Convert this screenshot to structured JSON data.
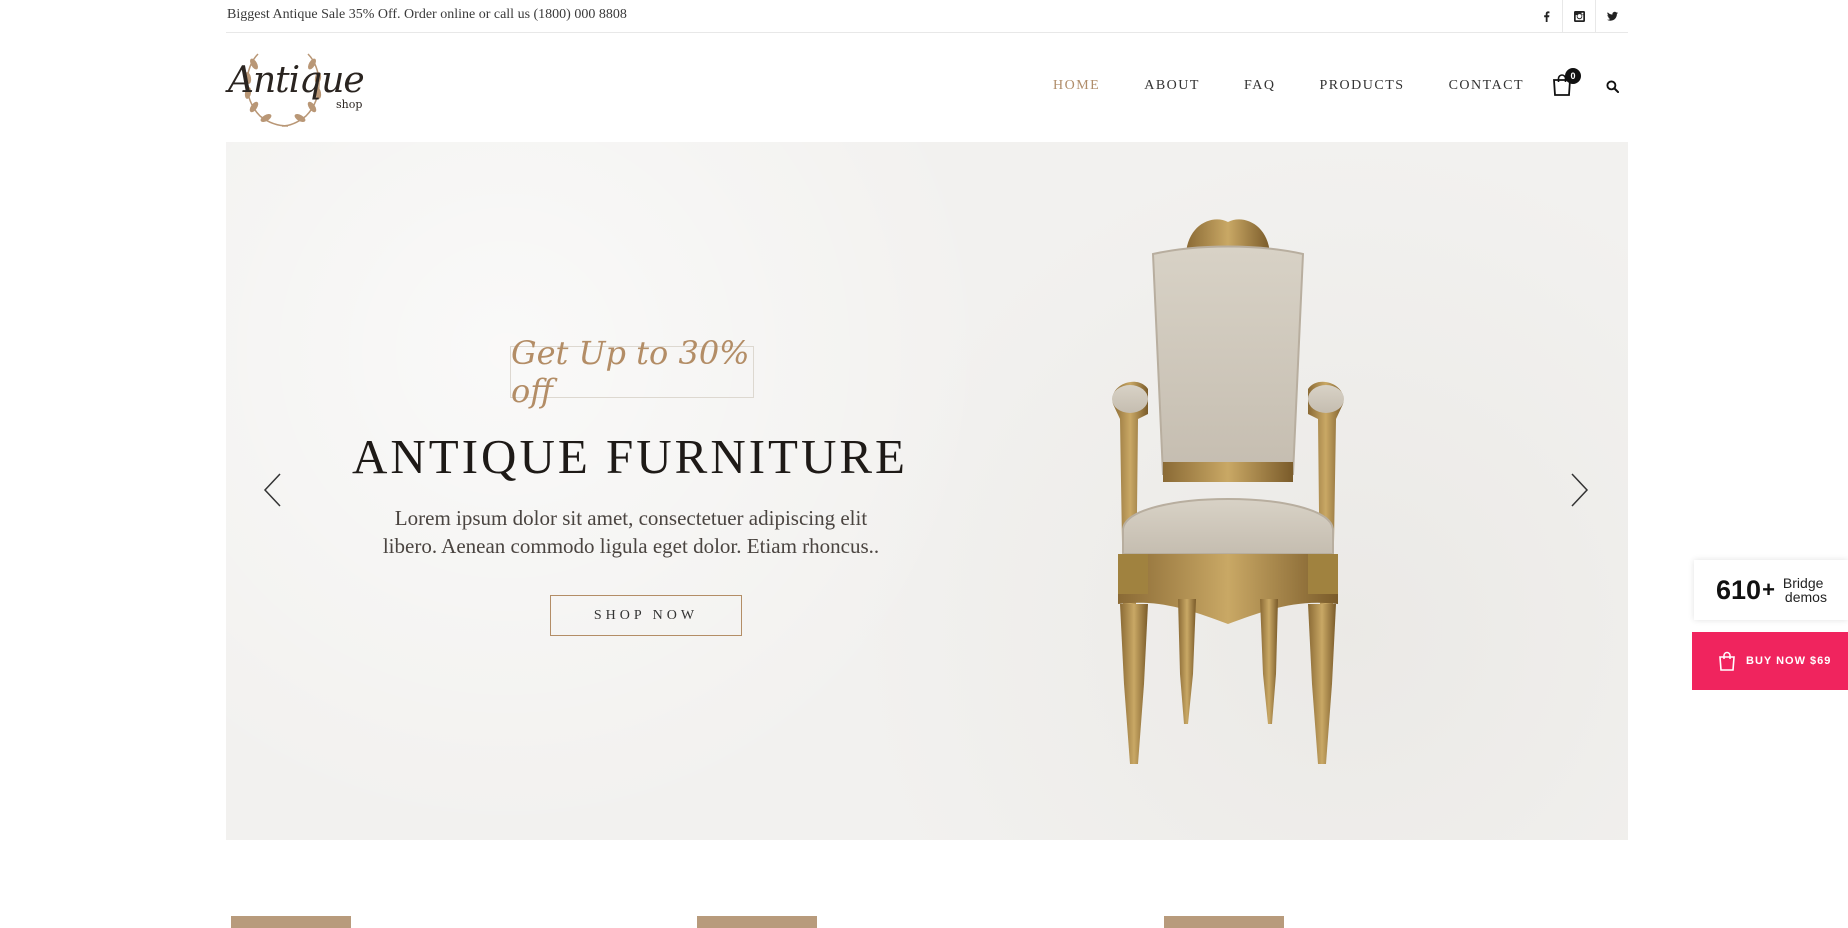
{
  "topbar": {
    "promo": "Biggest Antique Sale 35% Off. Order online or call us (1800) 000 8808",
    "socials": [
      "facebook-icon",
      "instagram-icon",
      "twitter-icon"
    ]
  },
  "logo": {
    "word": "Antique",
    "sub": "shop"
  },
  "nav": {
    "items": [
      {
        "label": "HOME",
        "active": true
      },
      {
        "label": "ABOUT"
      },
      {
        "label": "FAQ"
      },
      {
        "label": "PRODUCTS"
      },
      {
        "label": "CONTACT"
      }
    ],
    "cart_count": "0"
  },
  "hero": {
    "tag": "Get Up to 30% off",
    "title": "ANTIQUE FURNITURE",
    "text": "Lorem ipsum dolor sit amet, consectetuer adipiscing elit libero. Aenean commodo ligula eget dolor. Etiam rhoncus..",
    "button": "SHOP NOW"
  },
  "side": {
    "demos_num": "610",
    "demos_plus": "+",
    "demos_label_1": "Bridge",
    "demos_label_2": "demos",
    "buy_label": "BUY NOW $69"
  },
  "colors": {
    "accent": "#b08d6a",
    "buy": "#f0245e",
    "card": "#b89b7c"
  }
}
